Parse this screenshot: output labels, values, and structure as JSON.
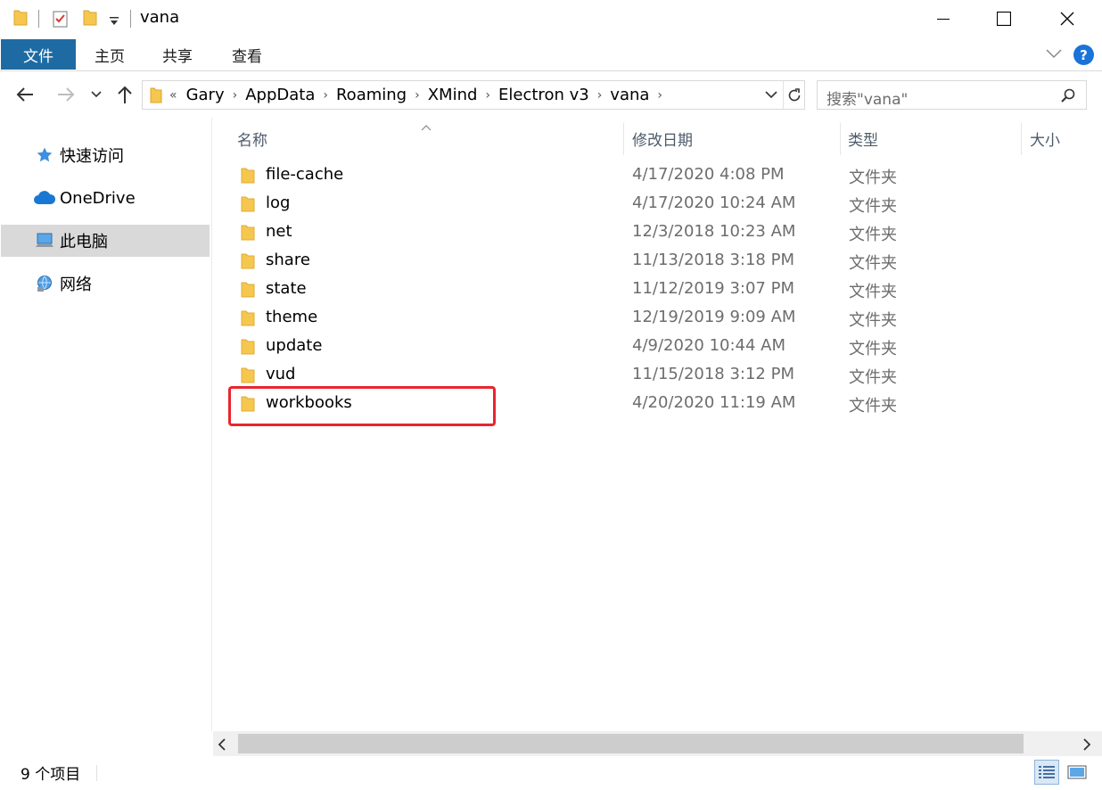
{
  "window": {
    "title": "vana"
  },
  "ribbon": {
    "tabs": [
      {
        "label": "文件",
        "active": true
      },
      {
        "label": "主页"
      },
      {
        "label": "共享"
      },
      {
        "label": "查看"
      }
    ],
    "help_label": "?"
  },
  "nav": {
    "breadcrumb": [
      "Gary",
      "AppData",
      "Roaming",
      "XMind",
      "Electron v3",
      "vana"
    ],
    "overflow_glyph": "«",
    "separator_glyph": "›",
    "search_placeholder": "搜索\"vana\""
  },
  "sidebar": {
    "items": [
      {
        "label": "快速访问",
        "icon": "star-icon"
      },
      {
        "label": "OneDrive",
        "icon": "cloud-icon"
      },
      {
        "label": "此电脑",
        "icon": "computer-icon",
        "selected": true
      },
      {
        "label": "网络",
        "icon": "network-icon"
      }
    ]
  },
  "columns": {
    "name": "名称",
    "date": "修改日期",
    "type": "类型",
    "size": "大小"
  },
  "files": [
    {
      "name": "file-cache",
      "date": "4/17/2020 4:08 PM",
      "type": "文件夹"
    },
    {
      "name": "log",
      "date": "4/17/2020 10:24 AM",
      "type": "文件夹"
    },
    {
      "name": "net",
      "date": "12/3/2018 10:23 AM",
      "type": "文件夹"
    },
    {
      "name": "share",
      "date": "11/13/2018 3:18 PM",
      "type": "文件夹"
    },
    {
      "name": "state",
      "date": "11/12/2019 3:07 PM",
      "type": "文件夹"
    },
    {
      "name": "theme",
      "date": "12/19/2019 9:09 AM",
      "type": "文件夹"
    },
    {
      "name": "update",
      "date": "4/9/2020 10:44 AM",
      "type": "文件夹"
    },
    {
      "name": "vud",
      "date": "11/15/2018 3:12 PM",
      "type": "文件夹"
    },
    {
      "name": "workbooks",
      "date": "4/20/2020 11:19 AM",
      "type": "文件夹",
      "highlighted": true
    }
  ],
  "status": {
    "item_count": "9 个项目"
  },
  "colors": {
    "file_tab": "#1e6ba4",
    "highlight_box": "#e8262d",
    "selection": "#d9d9d9",
    "folder": "#f5c74f"
  }
}
